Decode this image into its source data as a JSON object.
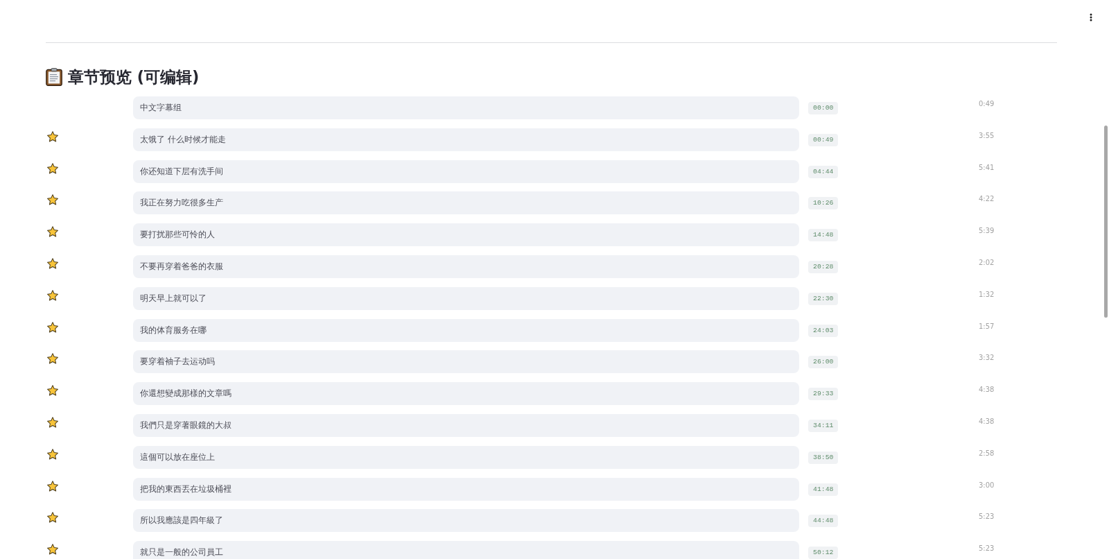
{
  "title": "章节预览 (可编辑)",
  "chapters": [
    {
      "title": "中文字幕组",
      "start": "00:00",
      "duration": "0:49",
      "starred": false
    },
    {
      "title": "太饿了 什么时候才能走",
      "start": "00:49",
      "duration": "3:55",
      "starred": true
    },
    {
      "title": "你还知道下层有洗手间",
      "start": "04:44",
      "duration": "5:41",
      "starred": true
    },
    {
      "title": "我正在努力吃很多生产",
      "start": "10:26",
      "duration": "4:22",
      "starred": true
    },
    {
      "title": "要打扰那些可怜的人",
      "start": "14:48",
      "duration": "5:39",
      "starred": true
    },
    {
      "title": "不要再穿着爸爸的衣服",
      "start": "20:28",
      "duration": "2:02",
      "starred": true
    },
    {
      "title": "明天早上就可以了",
      "start": "22:30",
      "duration": "1:32",
      "starred": true
    },
    {
      "title": "我的体育服务在哪",
      "start": "24:03",
      "duration": "1:57",
      "starred": true
    },
    {
      "title": "要穿着袖子去运动吗",
      "start": "26:00",
      "duration": "3:32",
      "starred": true
    },
    {
      "title": "你還想變成那樣的文章嗎",
      "start": "29:33",
      "duration": "4:38",
      "starred": true
    },
    {
      "title": "我們只是穿著眼鏡的大叔",
      "start": "34:11",
      "duration": "4:38",
      "starred": true
    },
    {
      "title": "這個可以放在座位上",
      "start": "38:50",
      "duration": "2:58",
      "starred": true
    },
    {
      "title": "把我的東西丟在垃圾桶裡",
      "start": "41:48",
      "duration": "3:00",
      "starred": true
    },
    {
      "title": "所以我應該是四年級了",
      "start": "44:48",
      "duration": "5:23",
      "starred": true
    },
    {
      "title": "就只是一般的公司員工",
      "start": "50:12",
      "duration": "5:23",
      "starred": true
    }
  ]
}
